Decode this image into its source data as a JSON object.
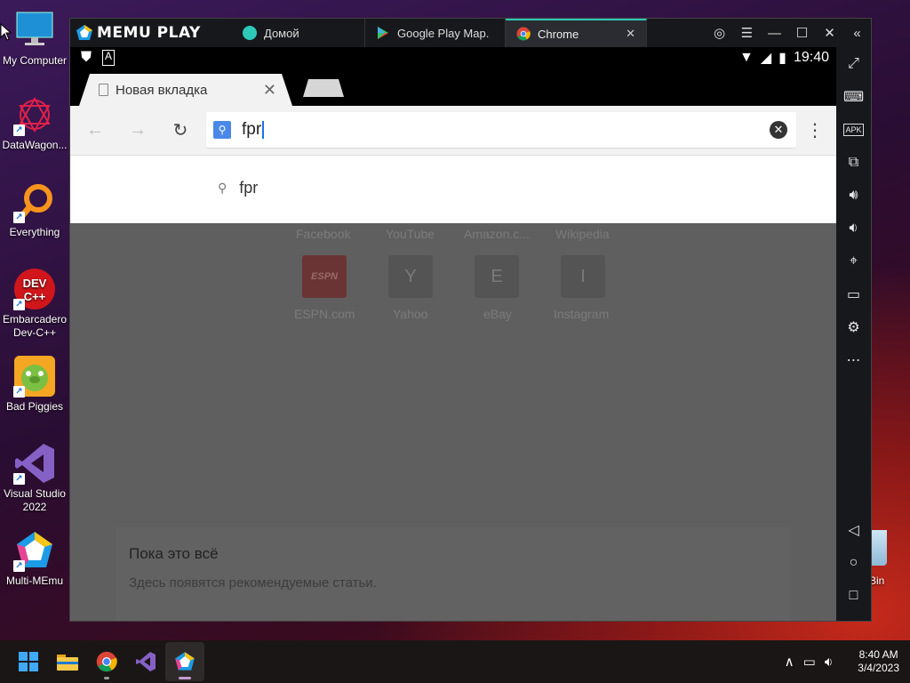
{
  "desktop": {
    "icons": [
      {
        "label": "My Computer",
        "icon": "monitor-icon"
      },
      {
        "label": "DataWagon...",
        "icon": "datawagon-icon"
      },
      {
        "label": "Everything",
        "icon": "everything-icon"
      },
      {
        "label": "Embarcadero Dev-C++",
        "icon": "devcpp-icon",
        "badge": "DEV C++"
      },
      {
        "label": "Bad Piggies",
        "icon": "bad-piggies-icon"
      },
      {
        "label": "Visual Studio 2022",
        "icon": "visual-studio-icon"
      },
      {
        "label": "Multi-MEmu",
        "icon": "multi-memu-icon"
      }
    ],
    "recycle_label": "e Bin"
  },
  "memu": {
    "brand": "MEMU PLAY",
    "tabs": [
      {
        "label": "Домой",
        "icon": "home-app-icon"
      },
      {
        "label": "Google Play Map.",
        "icon": "play-store-icon"
      },
      {
        "label": "Chrome",
        "icon": "chrome-icon",
        "close": "✕"
      }
    ],
    "controls": [
      "account-icon",
      "menu-icon",
      "minimize-icon",
      "maximize-icon",
      "close-icon",
      "collapse-icon"
    ],
    "status_time": "19:40",
    "sidebar": [
      "fullscreen-icon",
      "keyboard-icon",
      "apk-icon",
      "multi-window-icon",
      "volume-up-icon",
      "volume-down-icon",
      "location-icon",
      "folder-icon",
      "settings-icon",
      "more-icon",
      "back-icon",
      "home-icon",
      "recents-icon"
    ],
    "apk_label": "APK"
  },
  "chrome": {
    "tab_title": "Новая вкладка",
    "tab_close": "✕",
    "omnibox_value": "fpr",
    "suggestion": "fpr",
    "tiles_top": [
      "Facebook",
      "YouTube",
      "Amazon.c...",
      "Wikipedia"
    ],
    "tiles": [
      {
        "name": "ESPN.com",
        "letter": "ESPN"
      },
      {
        "name": "Yahoo",
        "letter": "Y"
      },
      {
        "name": "eBay",
        "letter": "E"
      },
      {
        "name": "Instagram",
        "letter": "I"
      }
    ],
    "card_title": "Пока это всё",
    "card_subtitle": "Здесь появятся рекомендуемые статьи."
  },
  "taskbar": {
    "apps": [
      "start-icon",
      "file-explorer-icon",
      "chrome-icon",
      "visual-studio-icon",
      "memu-icon"
    ],
    "time": "8:40 AM",
    "date": "3/4/2023"
  },
  "colors": {
    "memu_accent": "#2ec8b8",
    "chrome_blue": "#4a88e8",
    "espn_red": "#b01a1a"
  }
}
